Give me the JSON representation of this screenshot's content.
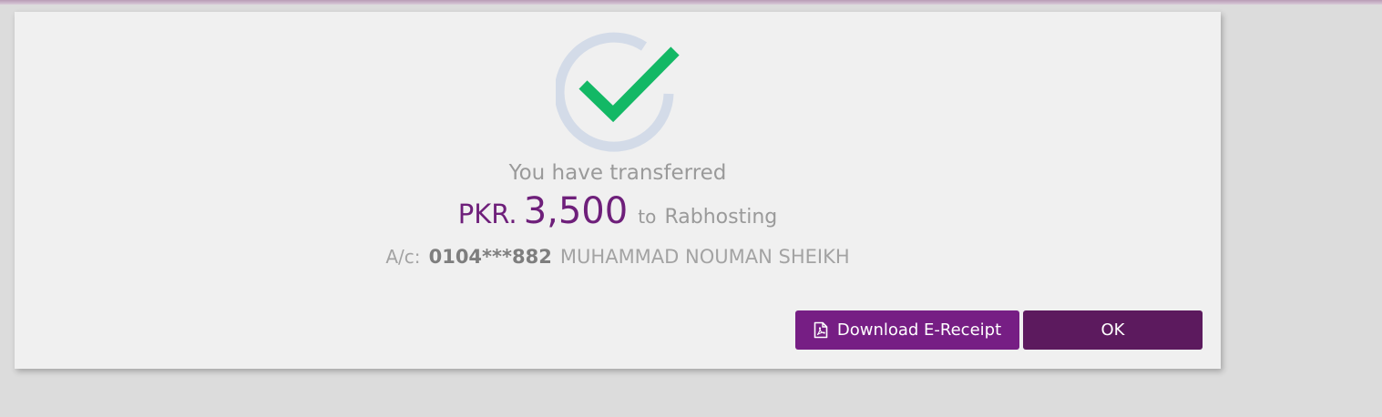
{
  "message": {
    "heading": "You have transferred",
    "currency": "PKR.",
    "amount": "3,500",
    "to_word": "to",
    "payee": "Rabhosting",
    "account_label": "A/c:",
    "account_number": "0104***882",
    "account_name": "MUHAMMAD NOUMAN SHEIKH"
  },
  "actions": {
    "download_label": "Download E-Receipt",
    "ok_label": "OK"
  },
  "icons": {
    "status": "success-check-icon",
    "download": "pdf-file-icon"
  },
  "colors": {
    "brand_purple": "#761e84",
    "ok_purple": "#5c1a5e",
    "amount_purple": "#6e1f7a",
    "check_green": "#13b865",
    "ring_blue": "#d3dbe8"
  }
}
